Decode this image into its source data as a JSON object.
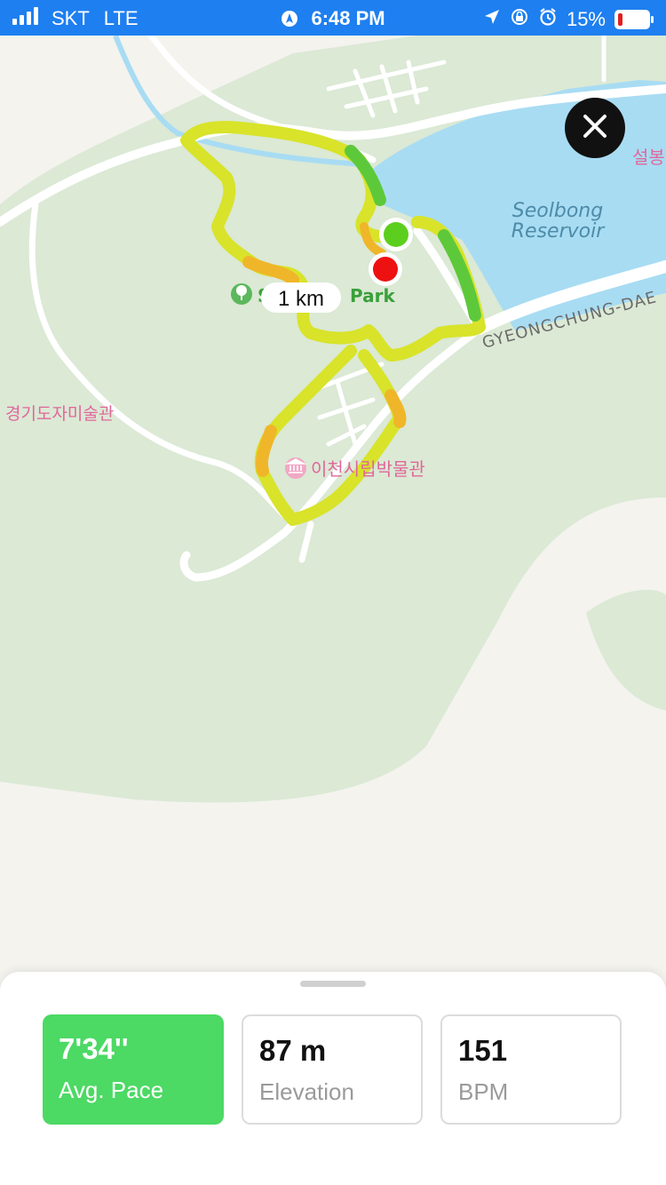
{
  "status_bar": {
    "carrier": "SKT",
    "network": "LTE",
    "time": "6:48 PM",
    "battery": "15%",
    "battery_level": 0.15
  },
  "map": {
    "labels": {
      "reservoir_line1": "Seolbong",
      "reservoir_line2": "Reservoir",
      "park_partial_s": "S",
      "park_partial_rest": "Park",
      "road": "GYEONGCHUNG-DAE",
      "poi_museum": "이천시립박물관",
      "poi_art": "경기도자미술관",
      "poi_edge": "설봉"
    },
    "distance_marker": "1 km"
  },
  "stats": [
    {
      "value": "7'34''",
      "label": "Avg. Pace",
      "active": true
    },
    {
      "value": "87 m",
      "label": "Elevation",
      "active": false
    },
    {
      "value": "151",
      "label": "BPM",
      "active": false
    }
  ],
  "colors": {
    "status_bar": "#1e7ff0",
    "water": "#a8dcf3",
    "park": "#dbe9d5",
    "route_green": "#4cc93a",
    "route_yellow": "#d8e32a",
    "route_orange": "#f0b62a",
    "start_marker": "#5ccf1e",
    "end_marker": "#ee1111",
    "active_card": "#4cd964"
  },
  "icons": [
    "signal-bars-icon",
    "navigation-icon",
    "location-arrow-icon",
    "rotation-lock-icon",
    "alarm-icon",
    "battery-icon",
    "close-icon",
    "park-tree-icon",
    "museum-icon"
  ]
}
